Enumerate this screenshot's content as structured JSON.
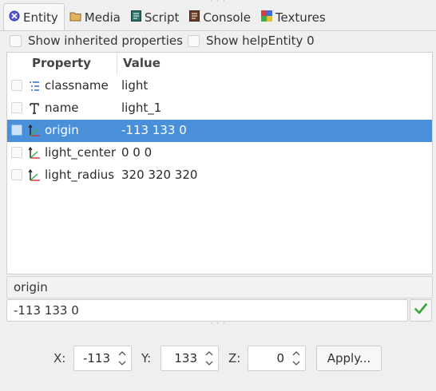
{
  "tabs": [
    {
      "label": "Entity",
      "icon": "entity-icon",
      "active": true
    },
    {
      "label": "Media",
      "icon": "folder-icon"
    },
    {
      "label": "Script",
      "icon": "script-icon"
    },
    {
      "label": "Console",
      "icon": "console-icon"
    },
    {
      "label": "Textures",
      "icon": "textures-icon"
    }
  ],
  "options": {
    "show_inherited_label": "Show inherited properties",
    "show_help_label": "Show help",
    "entity_label": "Entity 0"
  },
  "table": {
    "header_property": "Property",
    "header_value": "Value",
    "rows": [
      {
        "name": "classname",
        "value": "light",
        "icon": "list-icon"
      },
      {
        "name": "name",
        "value": "light_1",
        "icon": "text-icon"
      },
      {
        "name": "origin",
        "value": "-113 133 0",
        "icon": "axes-icon",
        "selected": true
      },
      {
        "name": "light_center",
        "value": "0 0 0",
        "icon": "axes-icon"
      },
      {
        "name": "light_radius",
        "value": "320 320 320",
        "icon": "axes-icon"
      }
    ]
  },
  "editor": {
    "key_value": "origin",
    "value_value": "-113 133 0"
  },
  "coords": {
    "x_label": "X:",
    "x_value": "-113",
    "y_label": "Y:",
    "y_value": "133",
    "z_label": "Z:",
    "z_value": "0",
    "apply_label": "Apply..."
  },
  "colors": {
    "selection": "#4a90d9",
    "ok_green": "#3aa335"
  }
}
